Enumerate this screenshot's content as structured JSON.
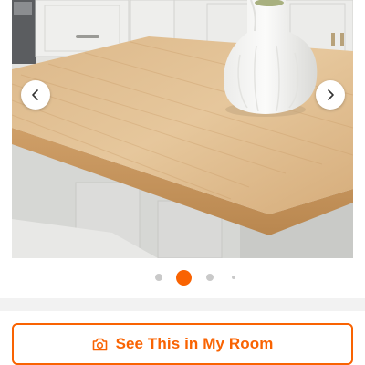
{
  "carousel": {
    "image_alt": "Butcher block countertop on a kitchen island with a white vase",
    "prev_icon": "chevron-left-icon",
    "next_icon": "chevron-right-icon",
    "slide_count": 4,
    "active_slide": 2
  },
  "room_button": {
    "label": "See This in My Room",
    "icon": "camera-icon"
  },
  "colors": {
    "accent": "#f96302",
    "dot_inactive": "#c9c9c9",
    "band": "#f2f2f2"
  }
}
